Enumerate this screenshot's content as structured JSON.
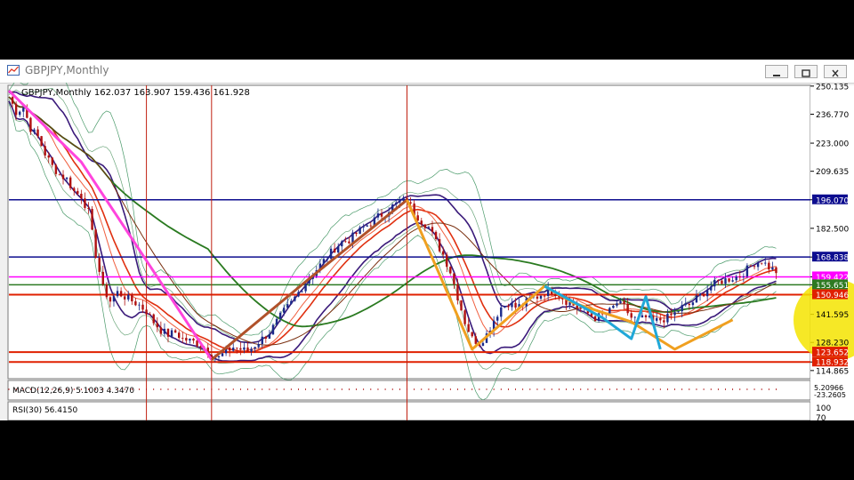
{
  "window": {
    "title": "GBPJPY,Monthly",
    "buttons": [
      "minimize-icon",
      "restore-icon",
      "close-icon"
    ]
  },
  "chart_data": {
    "type": "candlestick",
    "symbol_line": "GBPJPY,Monthly  162.037 163.907 159.436 161.928",
    "ylim": [
      111.0,
      250.5
    ],
    "y_ticks": [
      250.135,
      236.77,
      223.0,
      209.635,
      196.07,
      182.5,
      168.838,
      159.422,
      155.651,
      150.946,
      141.595,
      128.23,
      123.652,
      118.932,
      114.865
    ],
    "horizontal_levels": [
      {
        "value": 196.07,
        "color": "#0d0d8f",
        "label": "196.070"
      },
      {
        "value": 168.838,
        "color": "#0d0d8f",
        "label": "168.838"
      },
      {
        "value": 159.422,
        "color": "#ff00ff",
        "label": "159.422"
      },
      {
        "value": 155.651,
        "color": "#2d7a22",
        "label": "155.651"
      },
      {
        "value": 150.946,
        "color": "#e02000",
        "label": "150.946"
      },
      {
        "value": 123.652,
        "color": "#e02000",
        "label": "123.652"
      },
      {
        "value": 118.932,
        "color": "#e02000",
        "label": "118.932"
      }
    ],
    "price_path": [
      [
        0,
        245
      ],
      [
        3,
        238
      ],
      [
        6,
        240
      ],
      [
        9,
        230
      ],
      [
        12,
        226
      ],
      [
        15,
        218
      ],
      [
        18,
        212
      ],
      [
        21,
        208
      ],
      [
        24,
        206
      ],
      [
        27,
        200
      ],
      [
        30,
        198
      ],
      [
        33,
        190
      ],
      [
        36,
        170
      ],
      [
        39,
        154
      ],
      [
        42,
        148
      ],
      [
        45,
        152
      ],
      [
        48,
        150
      ],
      [
        51,
        148
      ],
      [
        54,
        146
      ],
      [
        57,
        143
      ],
      [
        60,
        138
      ],
      [
        63,
        134
      ],
      [
        66,
        132
      ],
      [
        69,
        133
      ],
      [
        72,
        130
      ],
      [
        75,
        129
      ],
      [
        78,
        128
      ],
      [
        81,
        126
      ],
      [
        84,
        122
      ],
      [
        87,
        121
      ],
      [
        90,
        124
      ],
      [
        93,
        126
      ],
      [
        96,
        125
      ],
      [
        99,
        124
      ],
      [
        102,
        127
      ],
      [
        105,
        130
      ],
      [
        108,
        133
      ],
      [
        111,
        138
      ],
      [
        114,
        143
      ],
      [
        117,
        147
      ],
      [
        120,
        152
      ],
      [
        123,
        157
      ],
      [
        126,
        161
      ],
      [
        129,
        165
      ],
      [
        132,
        169
      ],
      [
        135,
        173
      ],
      [
        138,
        176
      ],
      [
        141,
        177
      ],
      [
        144,
        180
      ],
      [
        147,
        183
      ],
      [
        150,
        185
      ],
      [
        153,
        188
      ],
      [
        156,
        190
      ],
      [
        159,
        193
      ],
      [
        162,
        195
      ],
      [
        165,
        196
      ],
      [
        168,
        190
      ],
      [
        171,
        186
      ],
      [
        174,
        183
      ],
      [
        177,
        176
      ],
      [
        180,
        170
      ],
      [
        183,
        162
      ],
      [
        186,
        150
      ],
      [
        189,
        138
      ],
      [
        192,
        130
      ],
      [
        195,
        128
      ],
      [
        198,
        132
      ],
      [
        201,
        139
      ],
      [
        204,
        145
      ],
      [
        207,
        147
      ],
      [
        210,
        145
      ],
      [
        213,
        146
      ],
      [
        216,
        149
      ],
      [
        219,
        150
      ],
      [
        222,
        152
      ],
      [
        225,
        153
      ],
      [
        228,
        151
      ],
      [
        231,
        148
      ],
      [
        234,
        146
      ],
      [
        237,
        144
      ],
      [
        240,
        142
      ],
      [
        243,
        140
      ],
      [
        246,
        141
      ],
      [
        249,
        143
      ],
      [
        252,
        147
      ],
      [
        255,
        145
      ],
      [
        258,
        140
      ],
      [
        261,
        139
      ],
      [
        264,
        140
      ],
      [
        267,
        138
      ],
      [
        270,
        139
      ],
      [
        273,
        140
      ],
      [
        276,
        142
      ],
      [
        279,
        145
      ],
      [
        282,
        146
      ],
      [
        285,
        149
      ],
      [
        288,
        152
      ],
      [
        291,
        155
      ],
      [
        294,
        157
      ],
      [
        297,
        158
      ],
      [
        300,
        159
      ],
      [
        303,
        160
      ],
      [
        306,
        163
      ],
      [
        309,
        166
      ],
      [
        312,
        167
      ],
      [
        315,
        164
      ],
      [
        318,
        162
      ]
    ],
    "pattern_lines": [
      {
        "color": "#ff44dd",
        "points": [
          [
            0,
            248
          ],
          [
            30,
            214
          ],
          [
            60,
            162
          ],
          [
            84,
            120
          ]
        ]
      },
      {
        "color": "#b0512a",
        "points": [
          [
            84,
            120
          ],
          [
            126,
            160
          ],
          [
            165,
            196
          ]
        ]
      },
      {
        "color": "#f0a020",
        "points": [
          [
            165,
            196
          ],
          [
            192,
            125
          ],
          [
            222,
            155
          ],
          [
            234,
            147
          ],
          [
            258,
            138
          ],
          [
            276,
            125
          ],
          [
            300,
            139
          ]
        ]
      },
      {
        "color": "#20a8d8",
        "points": [
          [
            222,
            155
          ],
          [
            246,
            140
          ],
          [
            258,
            130
          ],
          [
            264,
            150
          ],
          [
            270,
            125
          ]
        ]
      }
    ],
    "vertical_lines_x": [
      57,
      84,
      165
    ],
    "indicators": [
      {
        "name": "MACD(12,26,9) 5.1003 4.3470"
      },
      {
        "name": "RSI(30) 56.4150"
      }
    ],
    "sub_axis_labels": [
      "100",
      "70"
    ],
    "macd_tick": "5.20966",
    "macd_tick2": "-23.2605"
  }
}
